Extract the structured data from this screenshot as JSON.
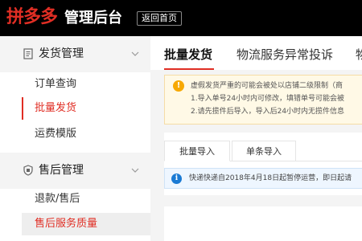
{
  "header": {
    "brand": "拼多多",
    "title": "管理后台",
    "home_button": "返回首页"
  },
  "sidebar": {
    "groups": [
      {
        "label": "发货管理",
        "icon": "document-icon",
        "items": [
          "订单查询",
          "批量发货",
          "运费模版"
        ]
      },
      {
        "label": "售后管理",
        "icon": "shield-icon",
        "items": [
          "退款/售后",
          "售后服务质量"
        ]
      }
    ],
    "active_item": "批量发货"
  },
  "main": {
    "tabs": [
      "批量发货",
      "物流服务异常投诉",
      "物"
    ],
    "active_tab": "批量发货",
    "warning": {
      "lines": [
        "虚假发货严重的可能会被处以店铺二级限制（商",
        "1.导入单号24小时内可修改，填错单号可能会被",
        "2.请先揽件后导入，导入后24小时内无揽件信息"
      ]
    },
    "subtabs": [
      "批量导入",
      "单条导入"
    ],
    "active_subtab": "批量导入",
    "info": "快递快递自2018年4月18日起暂停运营，即日起请"
  },
  "colors": {
    "brand_red": "#e02e24",
    "warning_bg": "#fff9e6",
    "warning_icon": "#f7a800",
    "info_bg": "#eef6ff",
    "info_icon": "#1a7ad4"
  }
}
